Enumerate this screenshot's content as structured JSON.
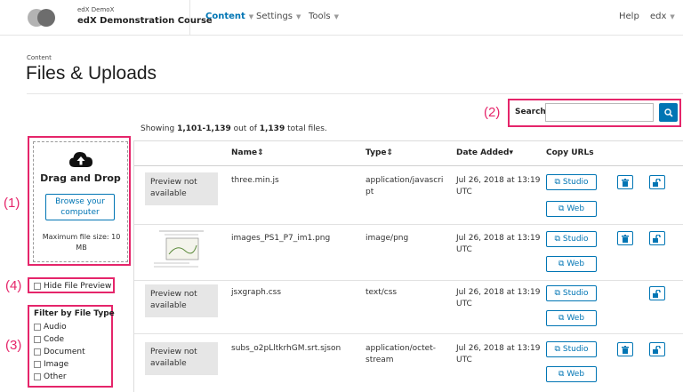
{
  "header": {
    "course_org": "edX DemoX",
    "course_name": "edX Demonstration Course",
    "nav": [
      "Content",
      "Settings",
      "Tools"
    ],
    "help": "Help",
    "user": "edx"
  },
  "page": {
    "breadcrumb": "Content",
    "title": "Files & Uploads"
  },
  "annotations": [
    "(1)",
    "(2)",
    "(3)",
    "(4)"
  ],
  "search": {
    "label": "Search",
    "value": ""
  },
  "showing": {
    "prefix": "Showing ",
    "range": "1,101-1,139",
    "middle": " out of ",
    "total": "1,139",
    "suffix": " total files."
  },
  "upload": {
    "title": "Drag and Drop",
    "browse": "Browse your computer",
    "max_size": "Maximum file size: 10 MB"
  },
  "hide_preview": "Hide File Preview",
  "filter": {
    "title": "Filter by File Type",
    "items": [
      "Audio",
      "Code",
      "Document",
      "Image",
      "Other"
    ]
  },
  "table": {
    "columns": [
      "Name",
      "Type",
      "Date Added",
      "Copy URLs"
    ],
    "studio_label": "Studio",
    "web_label": "Web",
    "preview_text": "Preview not available",
    "rows": [
      {
        "name": "three.min.js",
        "type_l1": "application/javascri",
        "type_l2": "pt",
        "date_l1": "Jul 26, 2018 at 13:19",
        "date_l2": "UTC"
      },
      {
        "name": "images_PS1_P7_im1.png",
        "type_l1": "image/png",
        "type_l2": "",
        "date_l1": "Jul 26, 2018 at 13:19",
        "date_l2": "UTC"
      },
      {
        "name": "jsxgraph.css",
        "type_l1": "text/css",
        "type_l2": "",
        "date_l1": "Jul 26, 2018 at 13:19",
        "date_l2": "UTC"
      },
      {
        "name": "subs_o2pLltkrhGM.srt.sjson",
        "type_l1": "application/octet-",
        "type_l2": "stream",
        "date_l1": "Jul 26, 2018 at 13:19",
        "date_l2": "UTC"
      }
    ]
  },
  "colors": {
    "accent": "#0075b4",
    "annotation": "#e5256a"
  }
}
